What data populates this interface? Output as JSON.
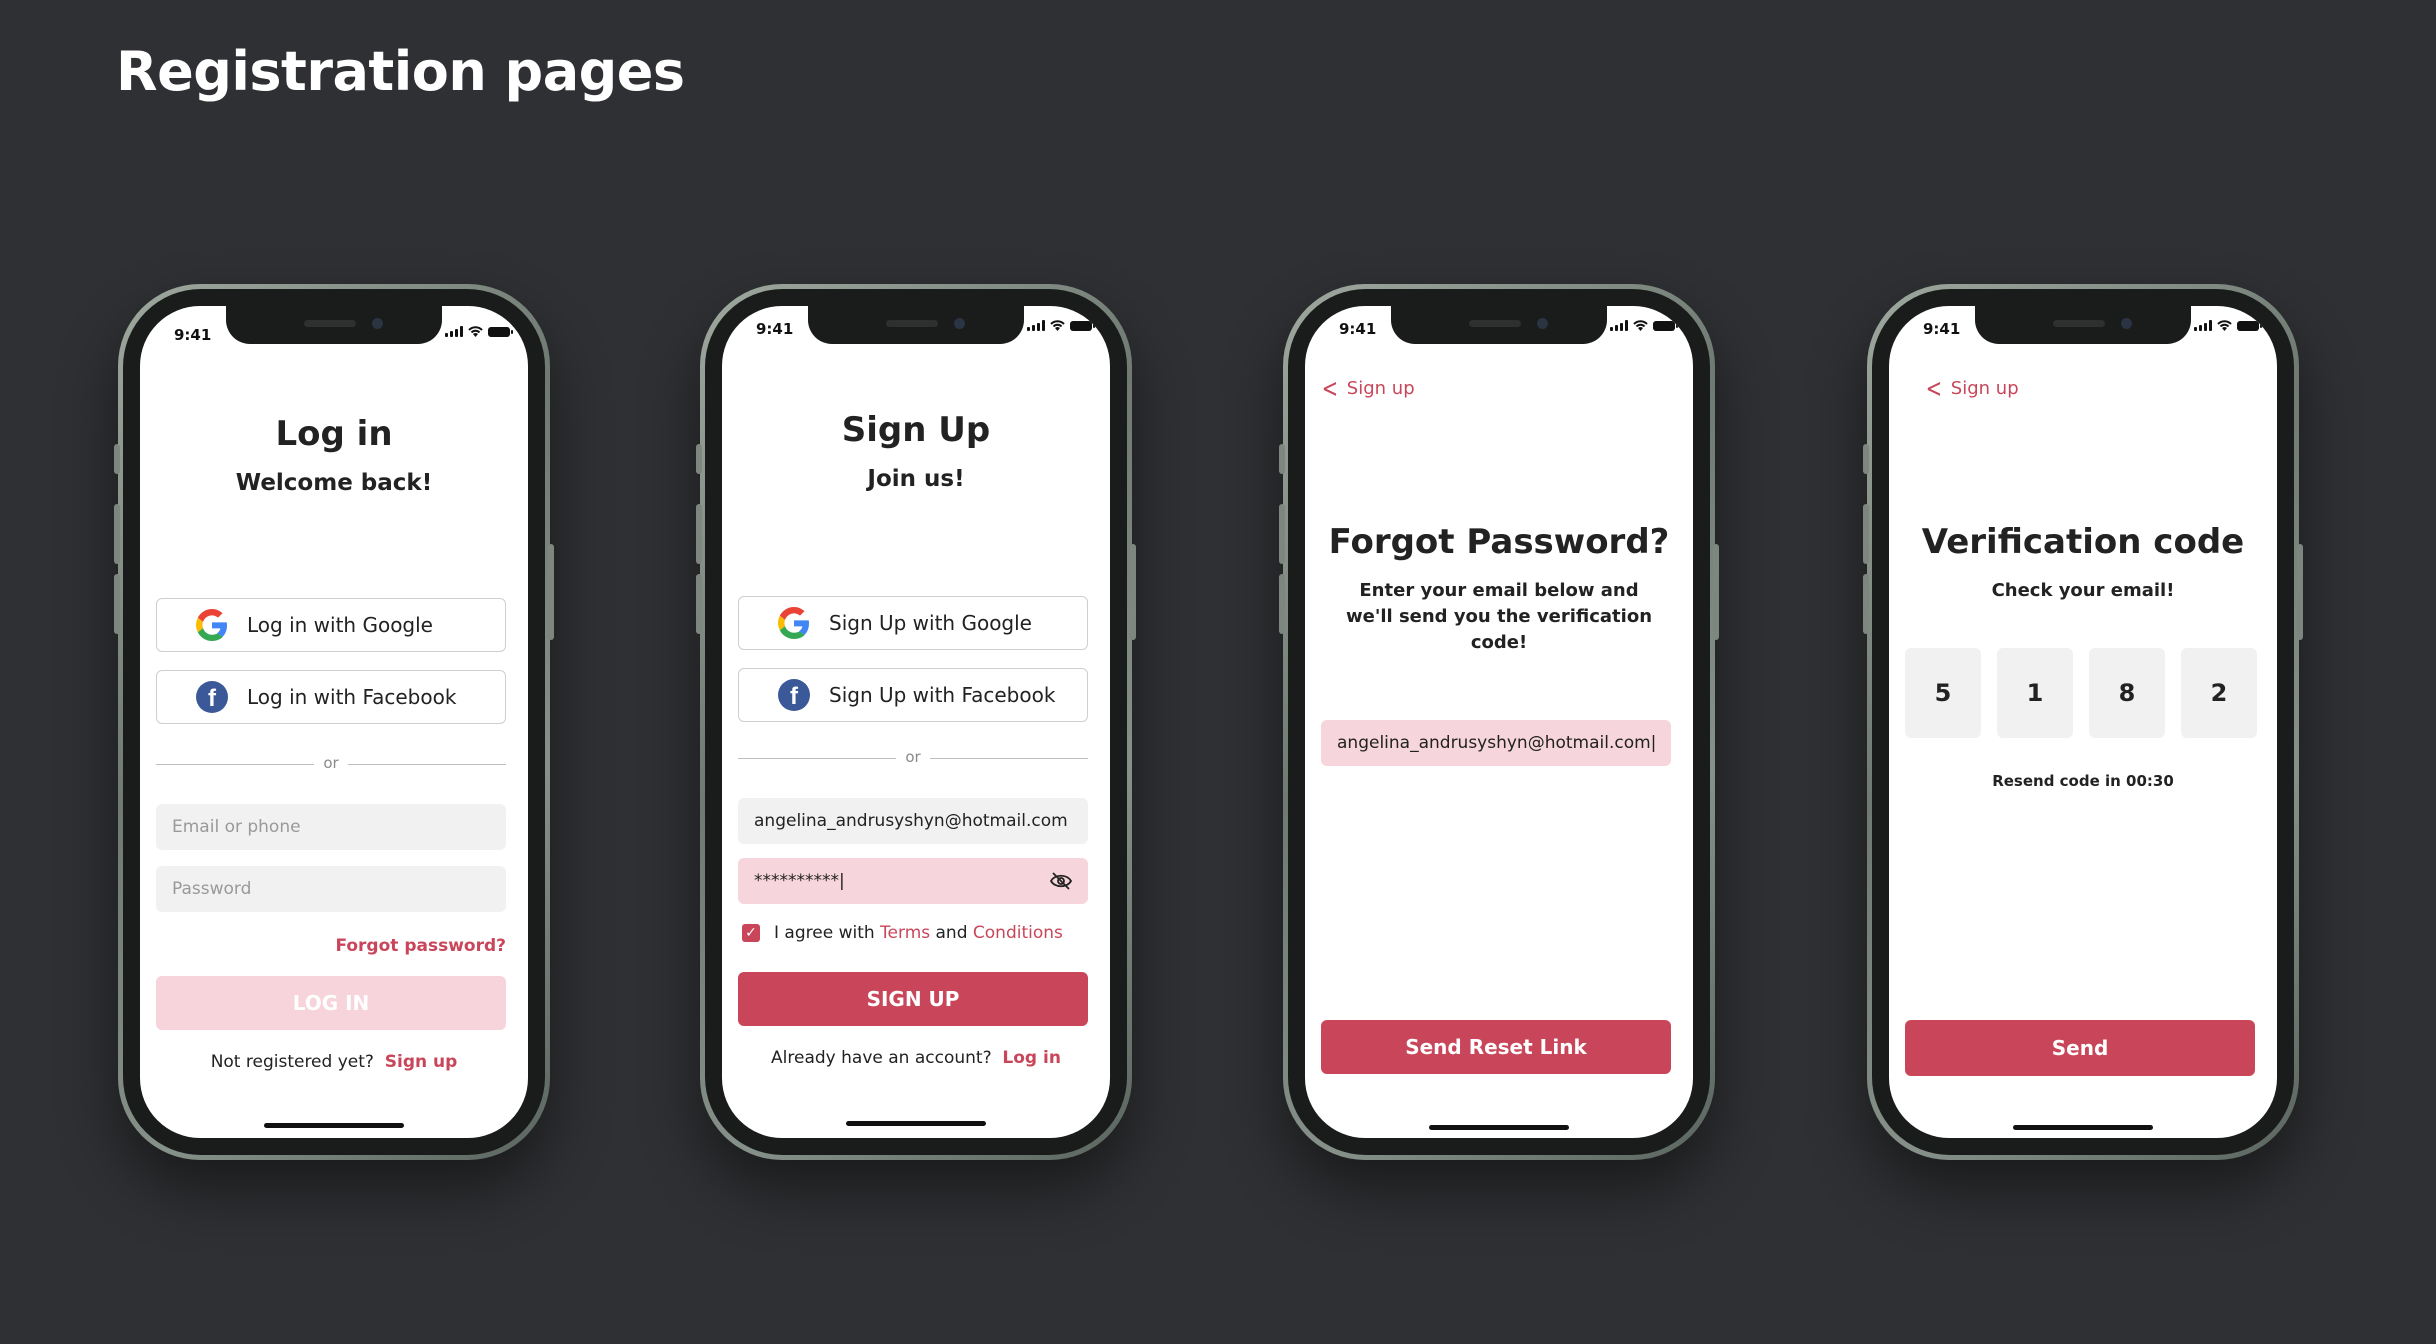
{
  "page": {
    "title": "Registration pages"
  },
  "status": {
    "time": "9:41"
  },
  "login": {
    "title": "Log in",
    "subtitle": "Welcome back!",
    "google_label": "Log in with Google",
    "facebook_label": "Log in with Facebook",
    "or": "or",
    "email_placeholder": "Email or phone",
    "password_placeholder": "Password",
    "forgot": "Forgot password?",
    "button": "LOG IN",
    "footer_text": "Not registered yet?",
    "footer_link": "Sign up"
  },
  "signup": {
    "title": "Sign Up",
    "subtitle": "Join us!",
    "google_label": "Sign Up with Google",
    "facebook_label": "Sign Up with Facebook",
    "or": "or",
    "email_value": "angelina_andrusyshyn@hotmail.com",
    "password_value": "**********|",
    "agree_prefix": "I agree with",
    "terms": "Terms",
    "and": "and",
    "conditions": "Conditions",
    "button": "SIGN UP",
    "footer_text": "Already have an account?",
    "footer_link": "Log in"
  },
  "forgot": {
    "back_label": "Sign up",
    "title": "Forgot Password?",
    "description": "Enter your email below and we'll send you the verification code!",
    "email_value": "angelina_andrusyshyn@hotmail.com|",
    "button": "Send Reset Link"
  },
  "verify": {
    "back_label": "Sign up",
    "title": "Verification code",
    "subtitle": "Check your email!",
    "digits": [
      "5",
      "1",
      "8",
      "2"
    ],
    "resend": "Resend code in 00:30",
    "button": "Send"
  },
  "colors": {
    "accent": "#c9465a",
    "accent_light": "#f7d4db",
    "background": "#2f3033",
    "facebook": "#3b5998"
  },
  "icons": [
    "google-icon",
    "facebook-icon",
    "eye-off-icon",
    "chevron-left-icon",
    "checkbox-icon",
    "signal-icon",
    "wifi-icon",
    "battery-icon"
  ]
}
